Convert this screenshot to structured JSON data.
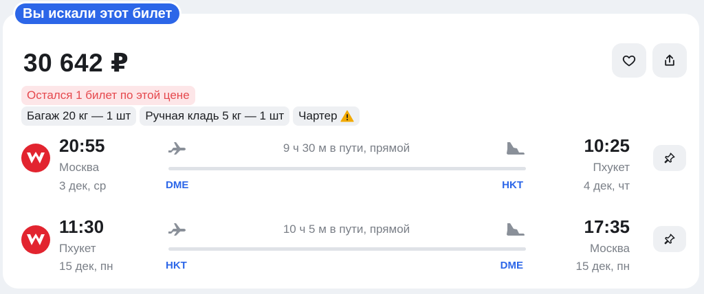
{
  "badge": "Вы искали этот билет",
  "price": "30 642 ₽",
  "warning": "Остался 1 билет по этой цене",
  "tags": {
    "baggage": "Багаж 20 кг — 1 шт",
    "carry_on": "Ручная кладь 5 кг — 1 шт",
    "charter": "Чартер"
  },
  "segments": [
    {
      "dep_time": "20:55",
      "dep_city": "Москва",
      "dep_date": "3 дек, ср",
      "dep_code": "DME",
      "duration": "9 ч 30 м в пути, прямой",
      "arr_time": "10:25",
      "arr_city": "Пхукет",
      "arr_date": "4 дек, чт",
      "arr_code": "HKT"
    },
    {
      "dep_time": "11:30",
      "dep_city": "Пхукет",
      "dep_date": "15 дек, пн",
      "dep_code": "HKT",
      "duration": "10 ч 5 м в пути, прямой",
      "arr_time": "17:35",
      "arr_city": "Москва",
      "arr_date": "15 дек, пн",
      "arr_code": "DME"
    }
  ],
  "colors": {
    "accent": "#2c66e8",
    "airline_red": "#e2242f",
    "warning_text": "#e5484d",
    "warning_bg": "#fde6e8"
  },
  "icons": [
    "heart-icon",
    "share-icon",
    "pin-icon",
    "warning-icon",
    "plane-takeoff-icon",
    "plane-landing-icon",
    "airline-logo"
  ]
}
